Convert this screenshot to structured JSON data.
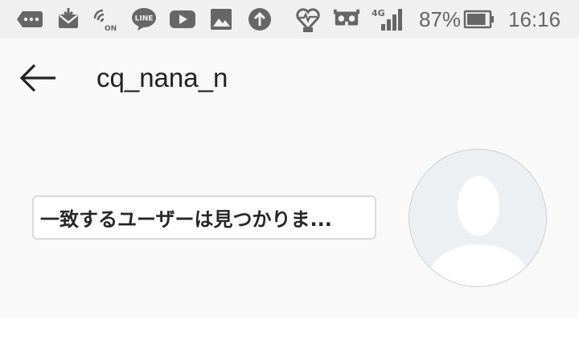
{
  "status_bar": {
    "icons": [
      "more-notifications-icon",
      "mail-icon",
      "nfc-on-icon",
      "line-app-icon",
      "youtube-icon",
      "gallery-icon",
      "upload-icon",
      "health-heart-icon",
      "vr-icon"
    ],
    "nfc_label": "ON",
    "line_label": "LINE",
    "network": "4G",
    "battery_percent": "87%",
    "battery_level": 0.87,
    "time": "16:16"
  },
  "header": {
    "title": "cq_nana_n"
  },
  "result": {
    "message": "一致するユーザーは見つかりま..."
  },
  "colors": {
    "status_bar_bg": "#f0f0f0",
    "status_icon": "#666666",
    "app_bg": "#f9f9f9",
    "chip_border": "#dbdbdb",
    "avatar_bg": "#edf0f2"
  }
}
